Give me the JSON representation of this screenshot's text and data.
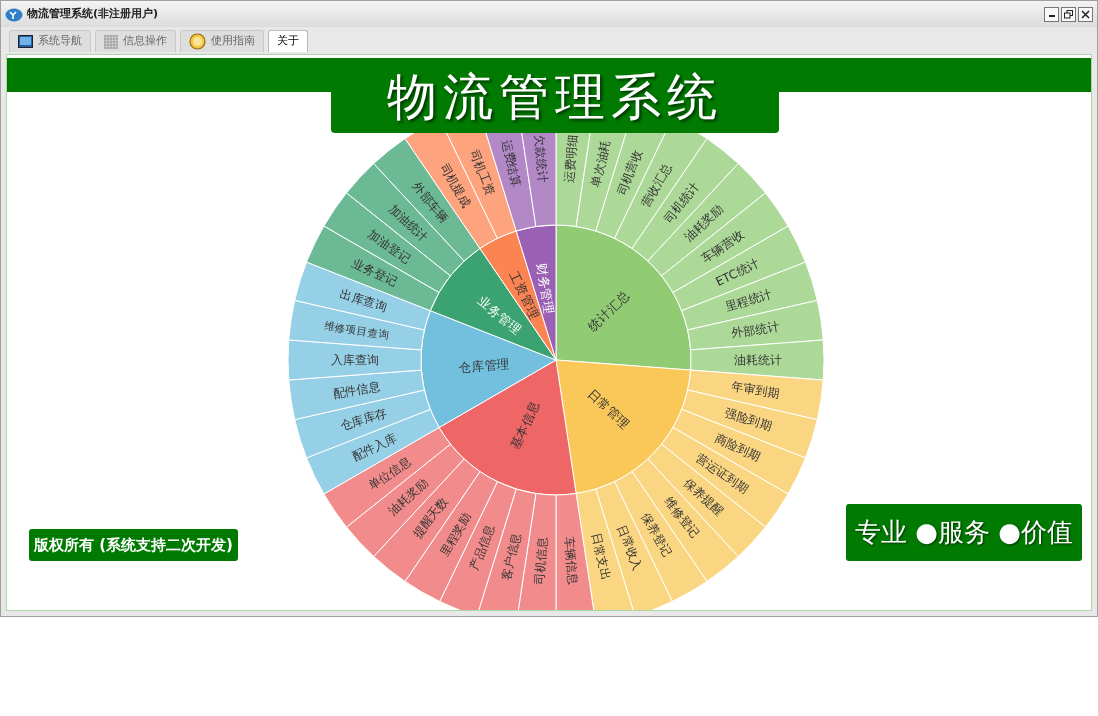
{
  "window": {
    "title": "物流管理系统(非注册用户)"
  },
  "tabs": [
    {
      "label": "系统导航",
      "selected": false
    },
    {
      "label": "信息操作",
      "selected": false
    },
    {
      "label": "使用指南",
      "selected": false
    },
    {
      "label": "关于",
      "selected": true
    }
  ],
  "banner": {
    "title": "物流管理系统"
  },
  "wheel": {
    "groups": [
      {
        "name": "统计汇总",
        "color": "#91cc75",
        "children": [
          "运费明细",
          "单次油耗",
          "司机营收",
          "营收汇总",
          "司机统计",
          "油耗奖励",
          "车辆营收",
          "ETC统计",
          "里程统计",
          "外部统计",
          "油耗统计"
        ]
      },
      {
        "name": "日常管理",
        "color": "#fac858",
        "children": [
          "年审到期",
          "强险到期",
          "商险到期",
          "营运证到期",
          "保养提醒",
          "维修登记",
          "保养登记",
          "日常收入",
          "日常支出"
        ]
      },
      {
        "name": "基本信息",
        "color": "#ee6666",
        "children": [
          "车辆信息",
          "司机信息",
          "客户信息",
          "产品信息",
          "里程奖励",
          "提醒天数",
          "油耗奖励",
          "单位信息"
        ]
      },
      {
        "name": "仓库管理",
        "color": "#73c0de",
        "children": [
          "配件入库",
          "仓库库存",
          "配件信息",
          "入库查询",
          "维修项目查询",
          "出库查询"
        ]
      },
      {
        "name": "业务管理",
        "color": "#3ba272",
        "children": [
          "业务登记",
          "加油登记",
          "加油统计",
          "外部车辆"
        ]
      },
      {
        "name": "工资管理",
        "color": "#fc8452",
        "children": [
          "司机提成",
          "司机工资"
        ]
      },
      {
        "name": "财务管理",
        "color": "#9a60b4",
        "children": [
          "运费结算",
          "欠款统计"
        ]
      }
    ]
  },
  "footer_left": "版权所有 (系统支持二次开发)",
  "footer_right": "专业 ●服务 ●价值"
}
